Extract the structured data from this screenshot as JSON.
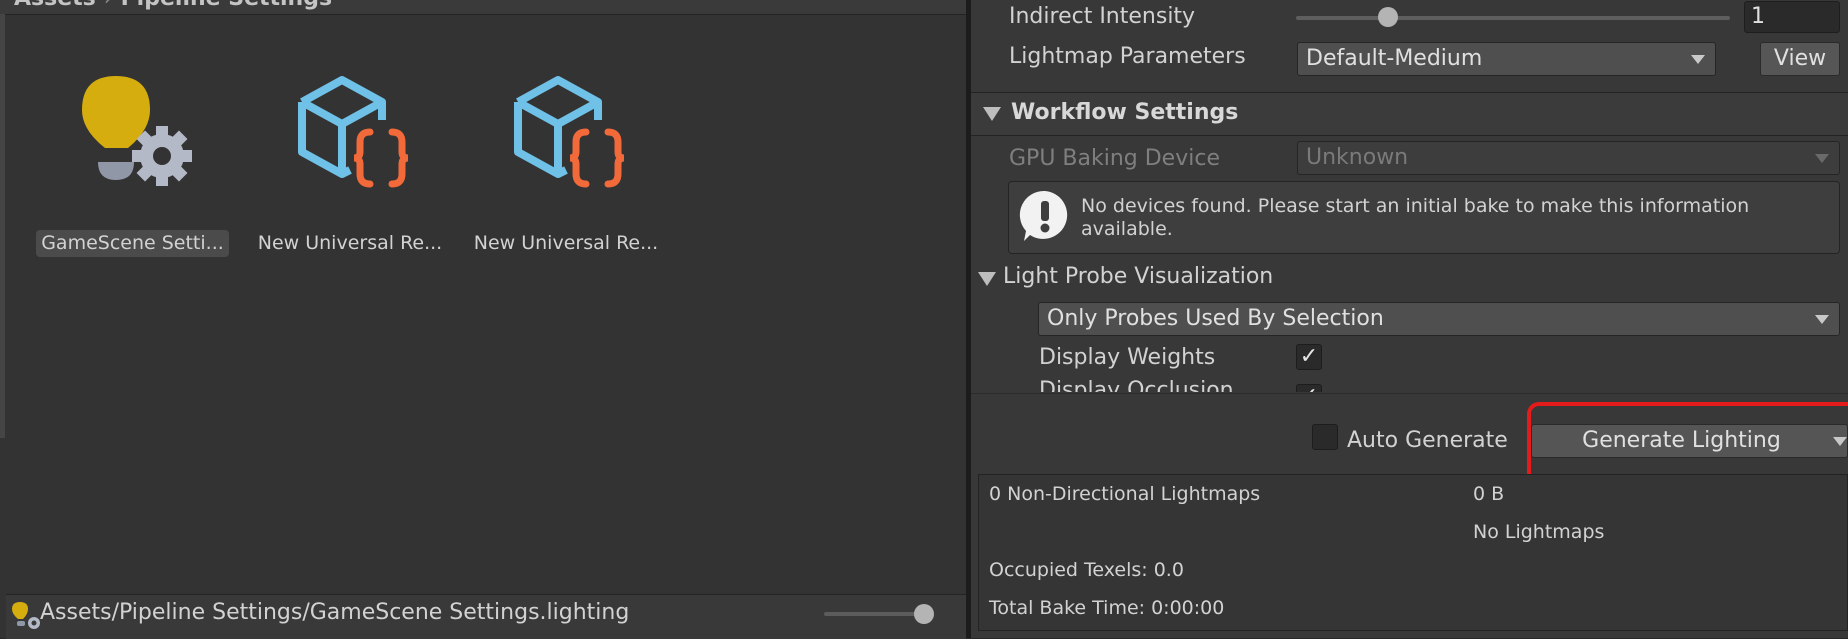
{
  "project_panel": {
    "breadcrumb": [
      "Assets",
      "Pipeline Settings"
    ],
    "assets": [
      {
        "label": "GameScene Setti...",
        "icon": "lighting-settings-icon"
      },
      {
        "label": "New Universal Re...",
        "icon": "render-pipeline-asset-icon"
      },
      {
        "label": "New Universal Re...",
        "icon": "render-pipeline-asset-icon"
      }
    ],
    "status_path": "Assets/Pipeline Settings/GameScene Settings.lighting"
  },
  "lighting": {
    "indirect_intensity": {
      "label": "Indirect Intensity",
      "value": "1"
    },
    "lightmap_parameters": {
      "label": "Lightmap Parameters",
      "value": "Default-Medium",
      "view_button": "View"
    },
    "workflow_settings": {
      "title": "Workflow Settings",
      "gpu_baking_device": {
        "label": "GPU Baking Device",
        "value": "Unknown"
      },
      "info_message": "No devices found. Please start an initial bake to make this information available."
    },
    "light_probe_visualization": {
      "title": "Light Probe Visualization",
      "mode": "Only Probes Used By Selection",
      "display_weights": {
        "label": "Display Weights",
        "checked": true
      },
      "display_occlusion": {
        "label": "Display Occlusion",
        "checked": true
      }
    },
    "auto_generate": {
      "label": "Auto Generate",
      "checked": false
    },
    "generate_button": "Generate Lighting",
    "stats": {
      "lightmaps": "0 Non-Directional Lightmaps",
      "size": "0 B",
      "no_lightmaps": "No Lightmaps",
      "occupied_texels": "Occupied Texels: 0.0",
      "total_bake_time": "Total Bake Time: 0:00:00"
    }
  },
  "colors": {
    "highlight": "#e41b1b",
    "lighting_icon": "#d6ad0e",
    "cube_icon": "#6fc1e8",
    "braces_icon": "#f2693a"
  }
}
